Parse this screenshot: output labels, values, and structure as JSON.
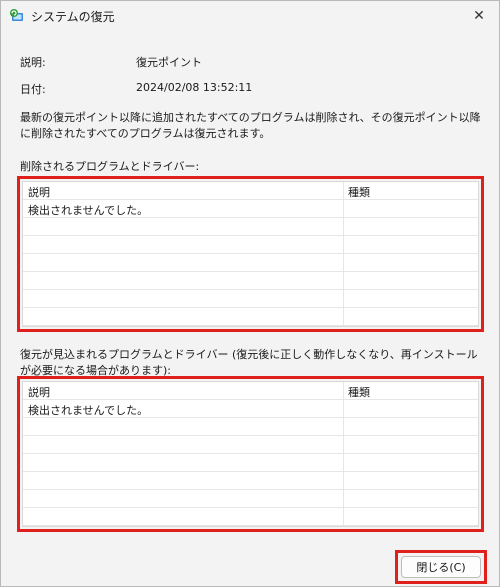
{
  "window": {
    "title": "システムの復元",
    "close_glyph": "✕"
  },
  "info": {
    "description_label": "説明:",
    "description_value": "復元ポイント",
    "date_label": "日付:",
    "date_value": "2024/02/08 13:52:11"
  },
  "message": "最新の復元ポイント以降に追加されたすべてのプログラムは削除され、その復元ポイント以降に削除されたすべてのプログラムは復元されます。",
  "deleted_section": {
    "caption": "削除されるプログラムとドライバー:",
    "columns": [
      "説明",
      "種類"
    ],
    "rows": [
      [
        "検出されませんでした。",
        ""
      ]
    ]
  },
  "restored_section": {
    "caption": "復元が見込まれるプログラムとドライバー (復元後に正しく動作しなくなり、再インストールが必要になる場合があります):",
    "columns": [
      "説明",
      "種類"
    ],
    "rows": [
      [
        "検出されませんでした。",
        ""
      ]
    ]
  },
  "buttons": {
    "close_label": "閉じる(C)"
  },
  "colors": {
    "highlight": "#e0201c",
    "window_bg": "#f3f3f3"
  }
}
